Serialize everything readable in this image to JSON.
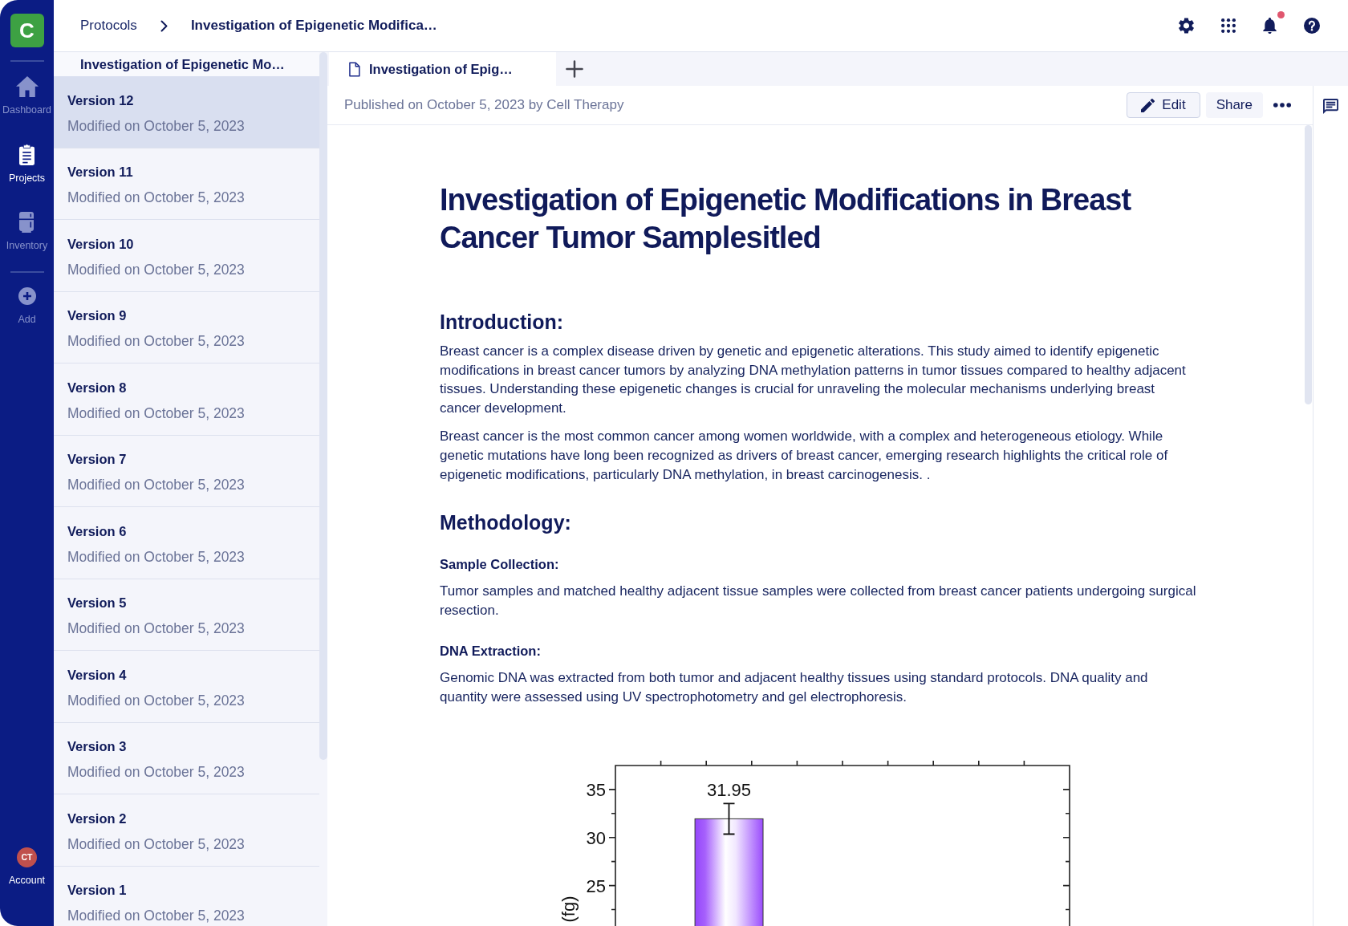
{
  "nav": {
    "logo": "C",
    "items": [
      {
        "label": "Dashboard",
        "kind": "home",
        "selected": false
      },
      {
        "label": "Projects",
        "kind": "projects",
        "selected": true
      },
      {
        "label": "Inventory",
        "kind": "inventory",
        "selected": false
      }
    ],
    "actions": [
      {
        "label": "Add",
        "kind": "add"
      }
    ],
    "account": {
      "initials": "CT",
      "label": "Account"
    }
  },
  "topbar": {
    "breadcrumb": [
      {
        "label": "Protocols",
        "kind": "link"
      },
      {
        "label": "Investigation of Epigenetic Modifica…",
        "kind": "current"
      }
    ],
    "notifications": {
      "unread": true
    }
  },
  "versions": {
    "title": "Investigation of Epigenetic Mo…",
    "items": [
      {
        "name": "Version 12",
        "modified": "Modified on October 5, 2023",
        "selected": true
      },
      {
        "name": "Version 11",
        "modified": "Modified on October 5, 2023",
        "selected": false
      },
      {
        "name": "Version 10",
        "modified": "Modified on October 5, 2023",
        "selected": false
      },
      {
        "name": "Version 9",
        "modified": "Modified on October 5, 2023",
        "selected": false
      },
      {
        "name": "Version 8",
        "modified": "Modified on October 5, 2023",
        "selected": false
      },
      {
        "name": "Version 7",
        "modified": "Modified on October 5, 2023",
        "selected": false
      },
      {
        "name": "Version 6",
        "modified": "Modified on October 5, 2023",
        "selected": false
      },
      {
        "name": "Version 5",
        "modified": "Modified on October 5, 2023",
        "selected": false
      },
      {
        "name": "Version 4",
        "modified": "Modified on October 5, 2023",
        "selected": false
      },
      {
        "name": "Version 3",
        "modified": "Modified on October 5, 2023",
        "selected": false
      },
      {
        "name": "Version 2",
        "modified": "Modified on October 5, 2023",
        "selected": false
      },
      {
        "name": "Version 1",
        "modified": "Modified on October 5, 2023",
        "selected": false
      }
    ]
  },
  "tabs": [
    {
      "label": "Investigation of Epig…",
      "selected": true
    }
  ],
  "document": {
    "published": "Published on October 5, 2023 by Cell Therapy",
    "actions": [
      {
        "label": "Edit",
        "kind": "edit"
      },
      {
        "label": "Share",
        "kind": "share"
      }
    ],
    "title": "Investigation of Epigenetic Modifications in Breast Cancer Tumor Samplesitled",
    "blocks": [
      {
        "kind": "heading",
        "text": "Introduction:"
      },
      {
        "kind": "paragraph",
        "text": "Breast cancer is a complex disease driven by genetic and epigenetic alterations. This study aimed to identify epigenetic modifications in breast cancer tumors by analyzing DNA methylation patterns in tumor tissues compared to healthy adjacent tissues. Understanding these epigenetic changes is crucial for unraveling the molecular mechanisms underlying breast cancer development."
      },
      {
        "kind": "paragraph",
        "text": "Breast cancer is the most common cancer among women worldwide, with a complex and heterogeneous etiology. While genetic mutations have long been recognized as drivers of breast cancer, emerging research highlights the critical role of epigenetic modifications, particularly DNA methylation, in breast carcinogenesis. ."
      },
      {
        "kind": "heading",
        "text": "Methodology:"
      },
      {
        "kind": "subheading",
        "text": "Sample Collection:"
      },
      {
        "kind": "paragraph",
        "text": "Tumor samples and matched healthy adjacent tissue samples were collected from breast cancer patients undergoing surgical resection."
      },
      {
        "kind": "subheading",
        "text": "DNA Extraction:"
      },
      {
        "kind": "paragraph",
        "text": "Genomic DNA was extracted from both tumor and adjacent healthy tissues using standard protocols. DNA quality and quantity were assessed using UV spectrophotometry and gel electrophoresis."
      }
    ],
    "chart_data": {
      "type": "bar",
      "ylabel": "(fg)",
      "categories": [
        null,
        null
      ],
      "values": [
        31.95,
        null
      ],
      "ylim": [
        20.7,
        37.5
      ],
      "yticks": [
        25,
        30,
        35
      ],
      "data_labels": true
    }
  }
}
